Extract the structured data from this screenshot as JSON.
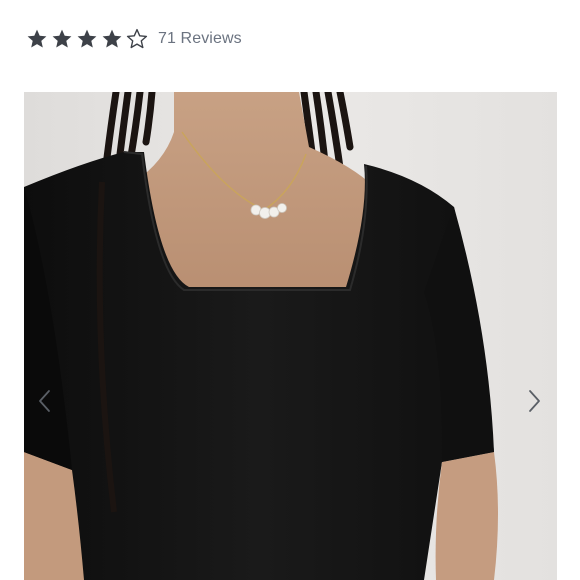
{
  "rating": {
    "value": 4,
    "max": 5,
    "filled_color": "#3d4148",
    "stars": [
      {
        "icon": "star-filled-icon"
      },
      {
        "icon": "star-filled-icon"
      },
      {
        "icon": "star-filled-icon"
      },
      {
        "icon": "star-filled-icon"
      },
      {
        "icon": "star-outline-icon"
      }
    ],
    "reviews_label": "71 Reviews"
  },
  "gallery": {
    "image_description_icon": "product-photo",
    "prev_icon": "chevron-left-icon",
    "next_icon": "chevron-right-icon",
    "arrow_color": "#5a5f66"
  }
}
